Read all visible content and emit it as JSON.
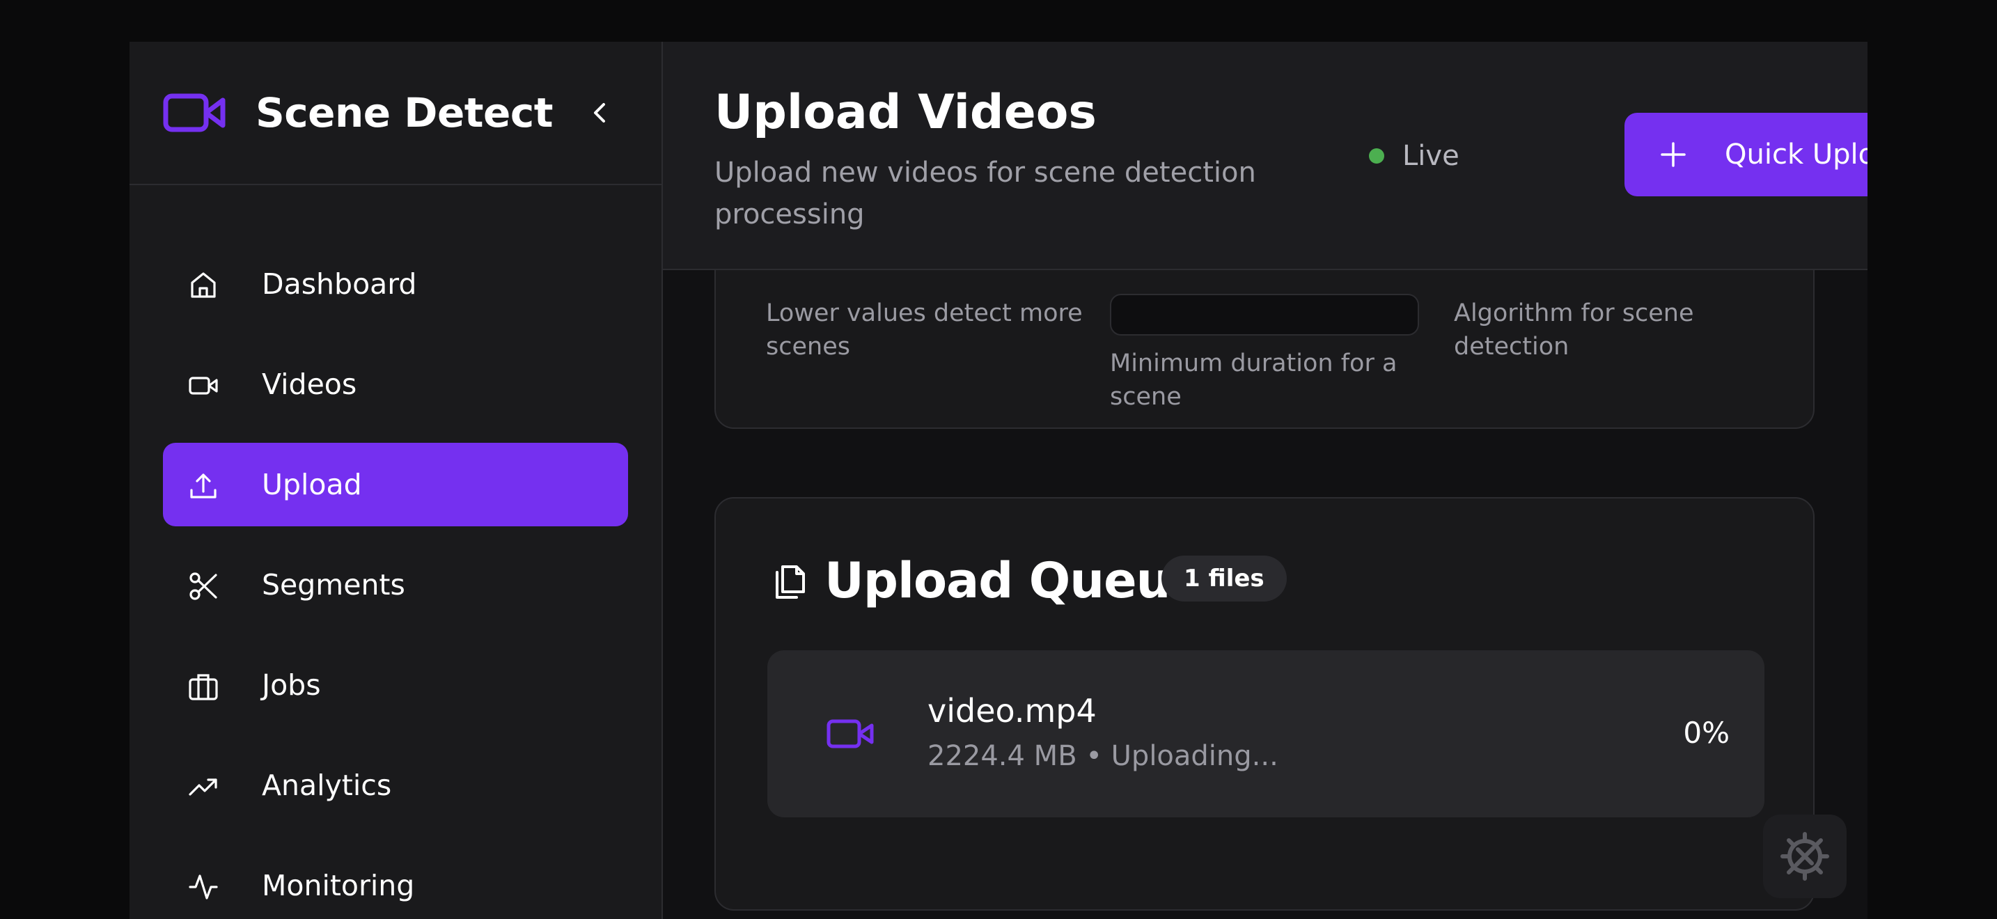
{
  "brand": {
    "title": "Scene Detect",
    "accent": "#7530f0"
  },
  "sidebar": {
    "items": [
      {
        "label": "Dashboard",
        "icon": "home-icon"
      },
      {
        "label": "Videos",
        "icon": "video-icon"
      },
      {
        "label": "Upload",
        "icon": "upload-icon",
        "active": true
      },
      {
        "label": "Segments",
        "icon": "scissors-icon"
      },
      {
        "label": "Jobs",
        "icon": "briefcase-icon"
      },
      {
        "label": "Analytics",
        "icon": "trending-up-icon"
      },
      {
        "label": "Monitoring",
        "icon": "activity-icon"
      }
    ]
  },
  "header": {
    "title": "Upload Videos",
    "subtitle": "Upload new videos for scene detection processing",
    "status": "Live",
    "status_color": "#4caf50",
    "quick_upload_label": "Quick Upload"
  },
  "settings": {
    "threshold_help": "Lower values detect more scenes",
    "min_duration_help": "Minimum duration for a scene",
    "algorithm_help": "Algorithm for scene detection"
  },
  "queue": {
    "title": "Upload Queue",
    "badge": "1 files",
    "files": [
      {
        "name": "video.mp4",
        "meta": "2224.4 MB • Uploading...",
        "progress": "0%"
      }
    ]
  }
}
